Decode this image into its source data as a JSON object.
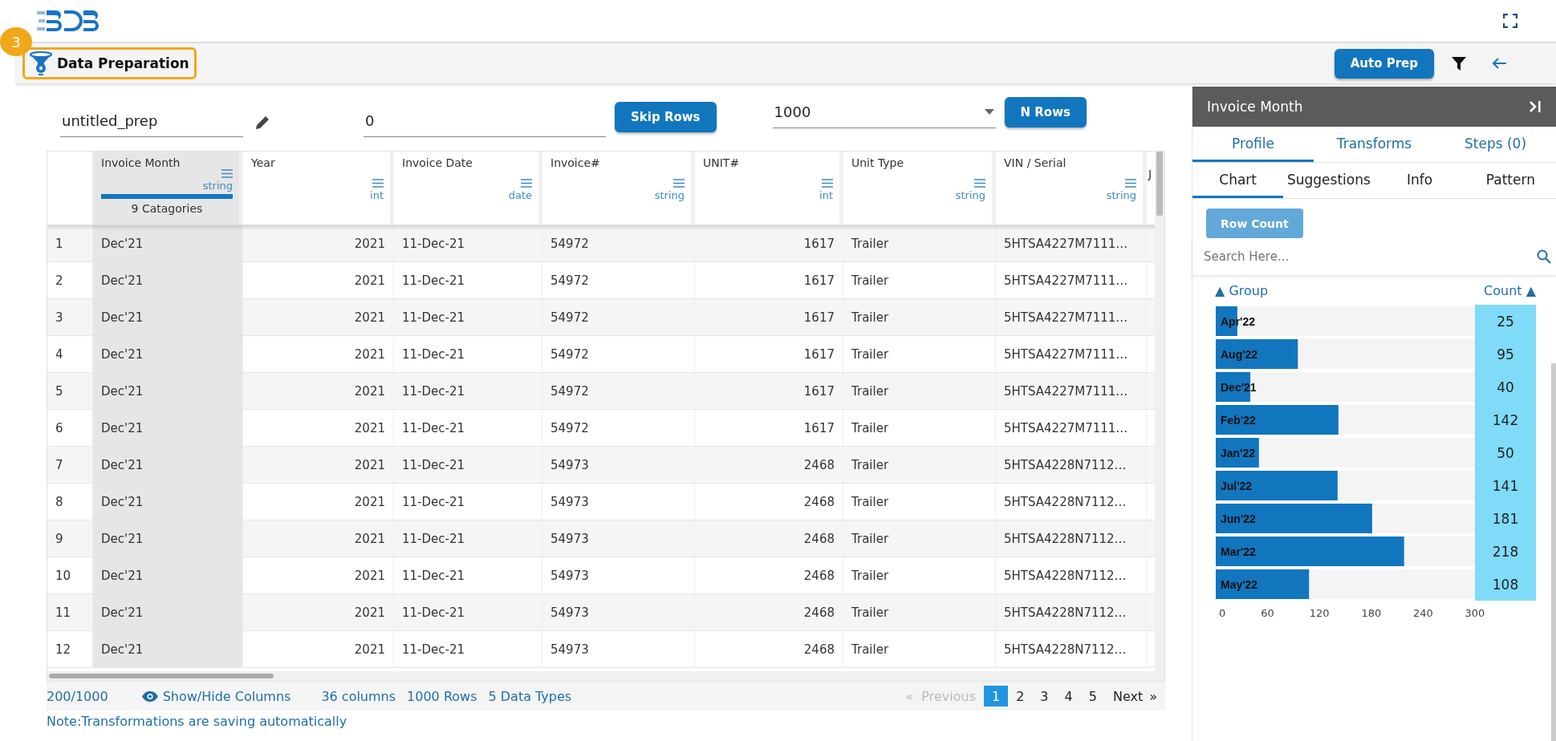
{
  "toolbar": {
    "step_badge": "3",
    "title": "Data Preparation",
    "auto_button": "Auto Prep"
  },
  "controls": {
    "name_field": "untitled_prep",
    "skip_field": "0",
    "skip_button": "Skip Rows",
    "rows_select": "1000",
    "rows_button": "N Rows"
  },
  "table": {
    "columns": [
      {
        "name": "Invoice Month",
        "type": "string",
        "selected": true,
        "categories": "9 Catagories"
      },
      {
        "name": "Year",
        "type": "int",
        "selected": false
      },
      {
        "name": "Invoice Date",
        "type": "date",
        "selected": false
      },
      {
        "name": "Invoice#",
        "type": "string",
        "selected": false
      },
      {
        "name": "UNIT#",
        "type": "int",
        "selected": false
      },
      {
        "name": "Unit Type",
        "type": "string",
        "selected": false
      },
      {
        "name": "VIN / Serial",
        "type": "string",
        "selected": false
      },
      {
        "name": "J",
        "kind": "cut"
      }
    ],
    "rows": [
      {
        "index": "1",
        "cells": [
          "Dec'21",
          "2021",
          "11-Dec-21",
          "54972",
          "1617",
          "Trailer",
          "5HTSA4227M7111…"
        ]
      },
      {
        "index": "2",
        "cells": [
          "Dec'21",
          "2021",
          "11-Dec-21",
          "54972",
          "1617",
          "Trailer",
          "5HTSA4227M7111…"
        ]
      },
      {
        "index": "3",
        "cells": [
          "Dec'21",
          "2021",
          "11-Dec-21",
          "54972",
          "1617",
          "Trailer",
          "5HTSA4227M7111…"
        ]
      },
      {
        "index": "4",
        "cells": [
          "Dec'21",
          "2021",
          "11-Dec-21",
          "54972",
          "1617",
          "Trailer",
          "5HTSA4227M7111…"
        ]
      },
      {
        "index": "5",
        "cells": [
          "Dec'21",
          "2021",
          "11-Dec-21",
          "54972",
          "1617",
          "Trailer",
          "5HTSA4227M7111…"
        ]
      },
      {
        "index": "6",
        "cells": [
          "Dec'21",
          "2021",
          "11-Dec-21",
          "54972",
          "1617",
          "Trailer",
          "5HTSA4227M7111…"
        ]
      },
      {
        "index": "7",
        "cells": [
          "Dec'21",
          "2021",
          "11-Dec-21",
          "54973",
          "2468",
          "Trailer",
          "5HTSA4228N7112…"
        ]
      },
      {
        "index": "8",
        "cells": [
          "Dec'21",
          "2021",
          "11-Dec-21",
          "54973",
          "2468",
          "Trailer",
          "5HTSA4228N7112…"
        ]
      },
      {
        "index": "9",
        "cells": [
          "Dec'21",
          "2021",
          "11-Dec-21",
          "54973",
          "2468",
          "Trailer",
          "5HTSA4228N7112…"
        ]
      },
      {
        "index": "10",
        "cells": [
          "Dec'21",
          "2021",
          "11-Dec-21",
          "54973",
          "2468",
          "Trailer",
          "5HTSA4228N7112…"
        ]
      },
      {
        "index": "11",
        "cells": [
          "Dec'21",
          "2021",
          "11-Dec-21",
          "54973",
          "2468",
          "Trailer",
          "5HTSA4228N7112…"
        ]
      },
      {
        "index": "12",
        "cells": [
          "Dec'21",
          "2021",
          "11-Dec-21",
          "54973",
          "2468",
          "Trailer",
          "5HTSA4228N7112…"
        ]
      }
    ]
  },
  "footer": {
    "record_count": "200/1000",
    "show_hide": "Show/Hide Columns",
    "stats": [
      "36 columns",
      "1000 Rows",
      "5 Data Types"
    ],
    "pagination": {
      "prev_mark": "«",
      "previous": "Previous",
      "previous_disabled": true,
      "pages": [
        {
          "label": "1",
          "selected": true
        },
        {
          "label": "2",
          "selected": false
        },
        {
          "label": "3",
          "selected": false
        },
        {
          "label": "4",
          "selected": false
        },
        {
          "label": "5",
          "selected": false
        }
      ],
      "next": "Next",
      "next_mark": "»"
    }
  },
  "note": "Note:Transformations are saving automatically",
  "panel": {
    "title": "Invoice Month",
    "tabs": [
      {
        "label": "Profile",
        "selected": true
      },
      {
        "label": "Transforms",
        "selected": false
      },
      {
        "label": "Steps (0)",
        "selected": false
      }
    ],
    "subtabs": [
      {
        "label": "Chart",
        "selected": true
      },
      {
        "label": "Suggestions",
        "selected": false
      },
      {
        "label": "Info",
        "selected": false
      },
      {
        "label": "Pattern",
        "selected": false
      }
    ],
    "mode_button": "Row Count",
    "search": {
      "placeholder": "Search Here..."
    },
    "group_header": {
      "mark": "▲",
      "label": "Group"
    },
    "count_header": {
      "mark": "▲"
    },
    "chart_data": {
      "type": "bar",
      "orientation": "horizontal",
      "categories": [
        "Apr'22",
        "Aug'22",
        "Dec'21",
        "Feb'22",
        "Jan'22",
        "Jul'22",
        "Jun'22",
        "Mar'22",
        "May'22"
      ],
      "series": [
        {
          "name": "Count",
          "color": "#1176be",
          "values": [
            25,
            95,
            40,
            142,
            50,
            141,
            181,
            218,
            108
          ]
        }
      ],
      "xlim": [
        0,
        300
      ],
      "xticks": [
        0,
        60,
        120,
        180,
        240,
        300
      ],
      "data_labels": true
    }
  }
}
